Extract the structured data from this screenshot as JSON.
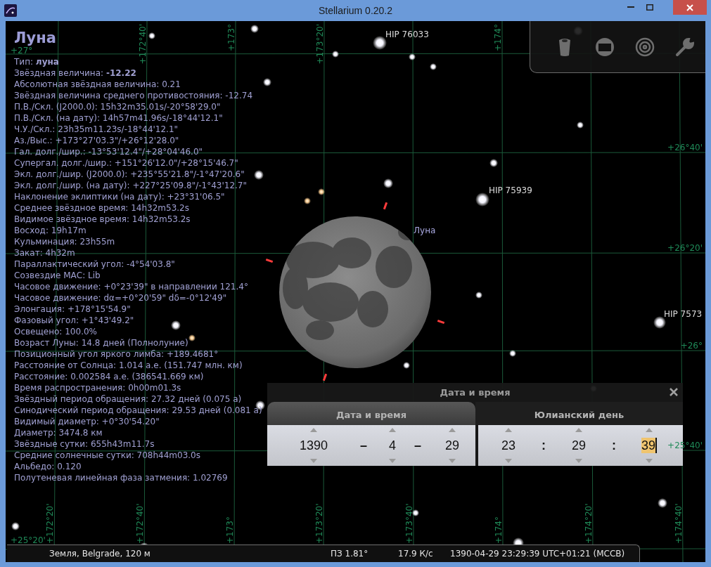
{
  "window": {
    "title": "Stellarium 0.20.2"
  },
  "info_panel": {
    "title": "Луна",
    "lines": [
      "Тип: **луна**",
      "Звёздная величина: **-12.22**",
      "Абсолютная звёздная величина: 0.21",
      "Звёздная величина среднего противостояния: -12.74",
      "П.В./Скл. (J2000.0): 15h32m35.01s/-20°58'29.0\"",
      "П.В./Скл. (на дату): 14h57m41.96s/-18°44'12.1\"",
      "Ч.У./Скл.: 23h35m11.23s/-18°44'12.1\"",
      "Аз./Выс.: +173°27'03.3\"/+26°12'28.0\"",
      "Гал. долг./шир.: -13°53'12.4\"/+28°04'46.0\"",
      "Супергал. долг./шир.: +151°26'12.0\"/+28°15'46.7\"",
      "Экл. долг./шир. (J2000.0): +235°55'21.8\"/-1°47'20.6\"",
      "Экл. долг./шир. (на дату): +227°25'09.8\"/-1°43'12.7\"",
      "Наклонение эклиптики (на дату): +23°31'06.5\"",
      "Среднее звёздное время: 14h32m53.2s",
      "Видимое звёздное время: 14h32m53.2s",
      "Восход: 19h17m",
      "Кульминация: 23h55m",
      "Закат: 4h32m",
      "Параллактический угол: -4°54'03.8\"",
      "Созвездие МАС: Lib",
      "Часовое движение: +0°23'39\" в направлении 121.4°",
      "Часовое движение: dα=+0°20'59\" dδ=-0°12'49\"",
      "Элонгация: +178°15'54.9\"",
      "Фазовый угол: +1°43'49.2\"",
      "Освещено: 100.0%",
      "Возраст Луны: 14.8 дней (Полнолуние)",
      "Позиционный угол яркого лимба: +189.4681°",
      "Расстояние от Солнца: 1.014 а.е. (151.747 млн. км)",
      "Расстояние: 0.002584 а.е. (386541.669 км)",
      "Время распространения: 0h00m01.3s",
      "Звёздный период обращения: 27.32 дней (0.075 a)",
      "Синодический период обращения: 29.53 дней (0.081 a)",
      "Видимый диаметр: +0°30'54.20\"",
      "Диаметр: 3474.8 км",
      "Звёздные сутки: 655h43m11.7s",
      "Средние солнечные сутки: 708h44m03.0s",
      "Альбедо: 0.120",
      "Полутеневая линейная фаза затмения: 1.02769"
    ]
  },
  "sky": {
    "labels": [
      {
        "kind": "star",
        "text": "HIP 76033"
      },
      {
        "kind": "star",
        "text": "HIP 75939"
      },
      {
        "kind": "star",
        "text": "HIP 7573"
      },
      {
        "kind": "planet",
        "text": "Луна"
      }
    ],
    "grid": {
      "meridians": [
        {
          "bottom_label": "+172°20'"
        },
        {
          "top_label": "+172°40'",
          "bottom_label": "+172°40'"
        },
        {
          "top_label": "+173°",
          "bottom_label": "+173°"
        },
        {
          "top_label": "+173°20'",
          "bottom_label": "+173°20'"
        },
        {
          "bottom_label": "+173°40'"
        },
        {
          "top_label": "+174°",
          "bottom_label": "+174°"
        },
        {
          "bottom_label": "+174°20'"
        },
        {
          "bottom_label": "+174°40'"
        }
      ],
      "parallels": [
        {
          "left_label": "+27°"
        },
        {
          "right_label": "+26°40'"
        },
        {
          "right_label": "+26°20'"
        },
        {
          "right_label": "+26°"
        },
        {
          "right_label": "+25°40'"
        },
        {
          "left_label": "+25°20'"
        }
      ]
    }
  },
  "date_time_dialog": {
    "title": "Дата и время",
    "tabs": [
      {
        "label": "Дата и время",
        "selected": true
      },
      {
        "label": "Юлианский день",
        "selected": false
      }
    ],
    "date_fields": [
      {
        "value": "1390",
        "focused": false
      },
      {
        "value": "4",
        "focused": false
      },
      {
        "value": "29",
        "focused": false
      }
    ],
    "date_separators": [
      "–",
      "–"
    ],
    "time_fields": [
      {
        "value": "23",
        "focused": false
      },
      {
        "value": "29",
        "focused": false
      },
      {
        "value": "39",
        "focused": true
      }
    ],
    "time_separators": [
      ":",
      ":"
    ]
  },
  "status_bar": {
    "location": "Земля, Belgrade, 120 м",
    "fov": "ПЗ 1.81°",
    "fps": "17.9 К/с",
    "datetime": "1390-04-29 23:29:39 UTC+01:21 (МССВ)"
  }
}
